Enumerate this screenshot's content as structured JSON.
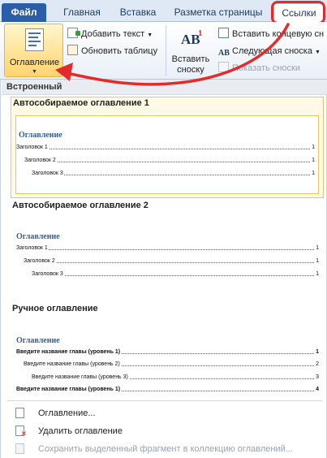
{
  "tabs": {
    "file": "Файл",
    "home": "Главная",
    "insert": "Вставка",
    "layout": "Разметка страницы",
    "references": "Ссылки"
  },
  "ribbon": {
    "toc_button": "Оглавление",
    "add_text": "Добавить текст",
    "update_table": "Обновить таблицу",
    "footnote_glyph": "AB",
    "footnote_superscript": "1",
    "insert_footnote_line1": "Вставить",
    "insert_footnote_line2": "сноску",
    "insert_endnote": "Вставить концевую сн",
    "next_footnote": "Следующая сноска",
    "next_footnote_glyph": "AB",
    "show_notes": "Показать сноски"
  },
  "gallery": {
    "section_title": "Встроенный",
    "items": [
      {
        "title": "Автособираемое оглавление 1",
        "heading": "Оглавление",
        "lines": [
          {
            "text": "Заголовок 1",
            "page": "1"
          },
          {
            "text": "Заголовок 2",
            "page": "1"
          },
          {
            "text": "Заголовок 3",
            "page": "1"
          }
        ]
      },
      {
        "title": "Автособираемое оглавление 2",
        "heading": "Оглавление",
        "lines": [
          {
            "text": "Заголовок 1",
            "page": "1"
          },
          {
            "text": "Заголовок 2",
            "page": "1"
          },
          {
            "text": "Заголовок 3",
            "page": "1"
          }
        ]
      },
      {
        "title": "Ручное оглавление",
        "heading": "Оглавление",
        "lines": [
          {
            "text": "Введите название главы (уровень 1)",
            "page": "1"
          },
          {
            "text": "Введите название главы (уровень 2)",
            "page": "2"
          },
          {
            "text": "Введите название главы (уровень 3)",
            "page": "3"
          },
          {
            "text": "Введите название главы (уровень 1)",
            "page": "4"
          }
        ]
      }
    ]
  },
  "menu": {
    "toc_settings": "Оглавление...",
    "remove_toc": "Удалить оглавление",
    "save_selection": "Сохранить выделенный фрагмент в коллекцию оглавлений..."
  },
  "colors": {
    "annotation": "#e42b2b",
    "selected_fill": "#fff9e5",
    "selected_border": "#e8c56b",
    "file_tab": "#2a5ea8"
  }
}
